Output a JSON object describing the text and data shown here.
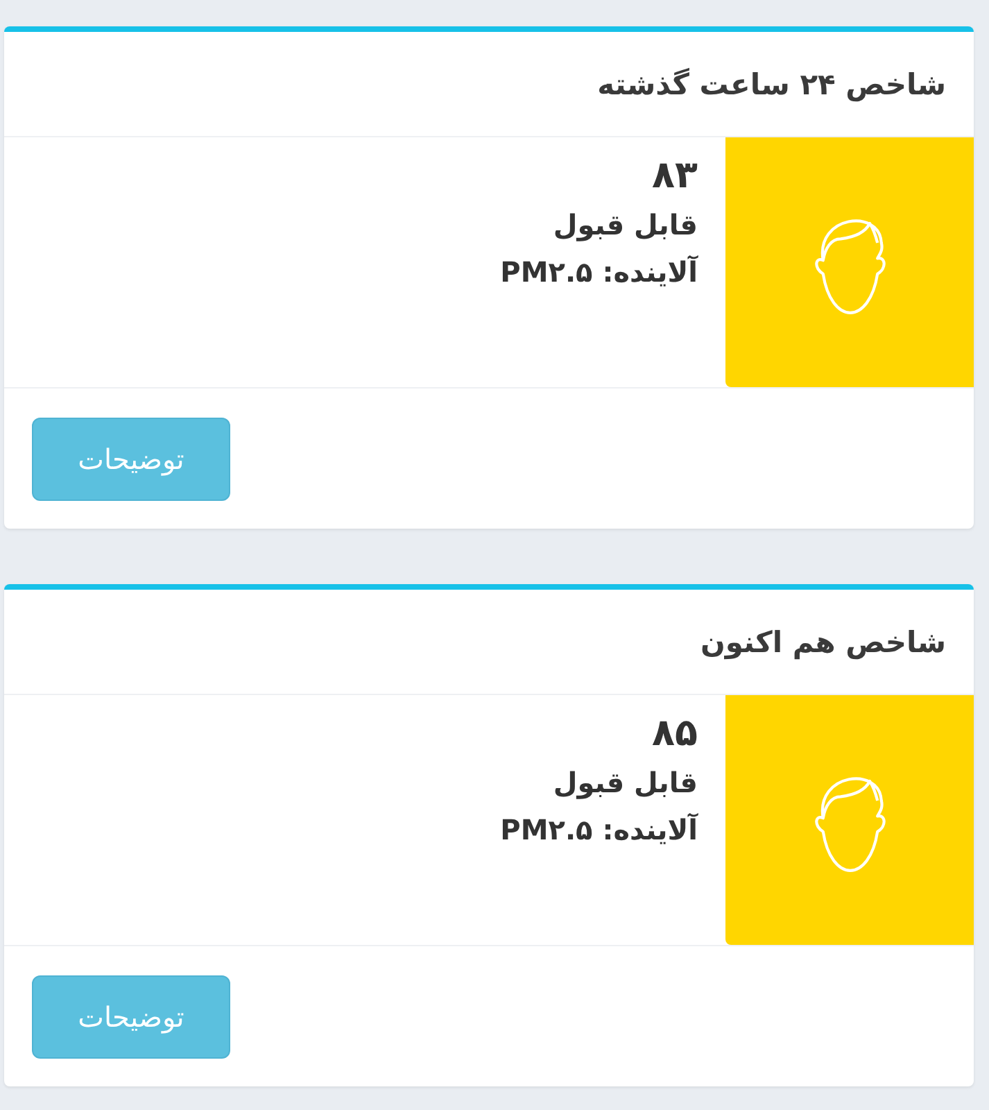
{
  "cards": [
    {
      "title": "شاخص ۲۴ ساعت گذشته",
      "value": "۸۳",
      "status": "قابل قبول",
      "pollutant": "آلاینده: PM۲.۵",
      "color": "#ffd600",
      "button": "توضیحات"
    },
    {
      "title": "شاخص هم اکنون",
      "value": "۸۵",
      "status": "قابل قبول",
      "pollutant": "آلاینده: PM۲.۵",
      "color": "#ffd600",
      "button": "توضیحات"
    }
  ]
}
